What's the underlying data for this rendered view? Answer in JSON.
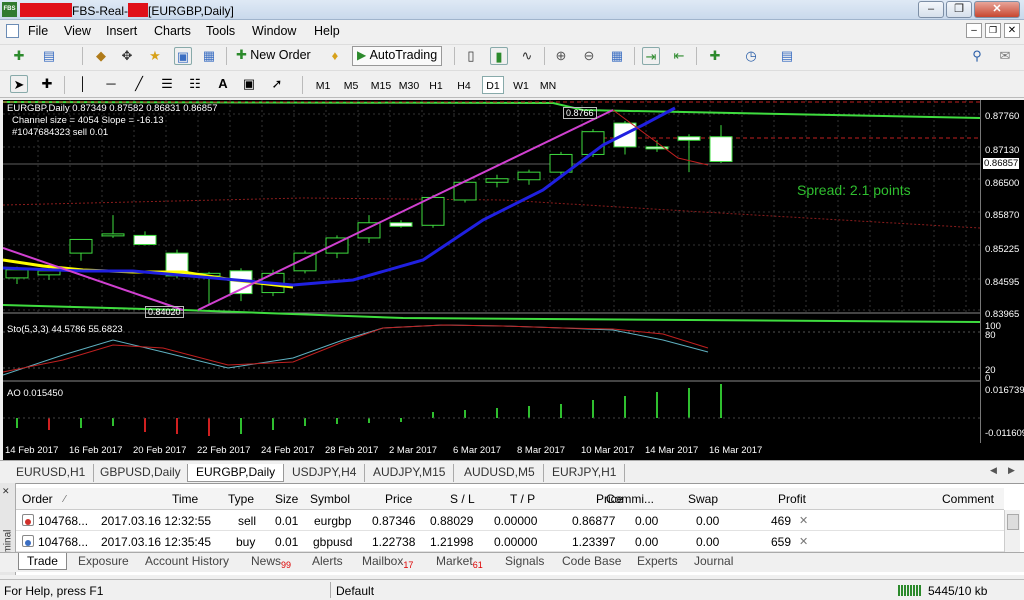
{
  "window": {
    "title": "FBS-Real-[EURGBP,Daily]",
    "app_icon_text": "FBS",
    "title_part1": "FBS-Real-",
    "title_part2": "[EURGBP,Daily]"
  },
  "menu": [
    "File",
    "View",
    "Insert",
    "Charts",
    "Tools",
    "Window",
    "Help"
  ],
  "toolbar": {
    "new_order": "New Order",
    "autotrading": "AutoTrading"
  },
  "timeframes": [
    "M1",
    "M5",
    "M15",
    "M30",
    "H1",
    "H4",
    "D1",
    "W1",
    "MN"
  ],
  "active_timeframe": "D1",
  "chart": {
    "header": "EURGBP,Daily  0.87349 0.87582 0.86831 0.86857",
    "channel_info": "Channel size = 4054 Slope = -16.13",
    "order_info": "#1047684323 sell 0.01",
    "spread": "Spread: 2.1 points",
    "high_label": "0.8766",
    "low_label": "0.84020",
    "price_labels": [
      "0.87760",
      "0.87130",
      "0.86857",
      "0.86500",
      "0.85870",
      "0.85225",
      "0.84595",
      "0.83965"
    ],
    "stoch_label": "Sto(5,3,3) 44.5786 55.6823",
    "stoch_levels": [
      "100",
      "80",
      "20",
      "0"
    ],
    "ao_label": "AO 0.015450",
    "ao_levels": [
      "0.016739",
      "-0.011609"
    ],
    "dates": [
      "14 Feb 2017",
      "16 Feb 2017",
      "20 Feb 2017",
      "22 Feb 2017",
      "24 Feb 2017",
      "28 Feb 2017",
      "2 Mar 2017",
      "6 Mar 2017",
      "8 Mar 2017",
      "10 Mar 2017",
      "14 Mar 2017",
      "16 Mar 2017"
    ]
  },
  "chart_data": {
    "type": "candlestick",
    "symbol": "EURGBP",
    "timeframe": "Daily",
    "ylim": [
      0.83965,
      0.8776
    ],
    "candles": [
      {
        "o": 0.8456,
        "h": 0.8478,
        "l": 0.8444,
        "c": 0.8472
      },
      {
        "o": 0.8462,
        "h": 0.8478,
        "l": 0.8452,
        "c": 0.847
      },
      {
        "o": 0.8505,
        "h": 0.8528,
        "l": 0.849,
        "c": 0.8532
      },
      {
        "o": 0.854,
        "h": 0.858,
        "l": 0.8535,
        "c": 0.8543
      },
      {
        "o": 0.854,
        "h": 0.8548,
        "l": 0.852,
        "c": 0.8522
      },
      {
        "o": 0.8505,
        "h": 0.8512,
        "l": 0.8455,
        "c": 0.846
      },
      {
        "o": 0.846,
        "h": 0.8468,
        "l": 0.8402,
        "c": 0.8465
      },
      {
        "o": 0.847,
        "h": 0.8475,
        "l": 0.841,
        "c": 0.8425
      },
      {
        "o": 0.8427,
        "h": 0.8472,
        "l": 0.842,
        "c": 0.8465
      },
      {
        "o": 0.847,
        "h": 0.851,
        "l": 0.8465,
        "c": 0.8505
      },
      {
        "o": 0.8505,
        "h": 0.854,
        "l": 0.8495,
        "c": 0.8535
      },
      {
        "o": 0.8535,
        "h": 0.858,
        "l": 0.8525,
        "c": 0.8565
      },
      {
        "o": 0.8565,
        "h": 0.857,
        "l": 0.8555,
        "c": 0.8558
      },
      {
        "o": 0.856,
        "h": 0.862,
        "l": 0.8555,
        "c": 0.8615
      },
      {
        "o": 0.861,
        "h": 0.865,
        "l": 0.8605,
        "c": 0.8645
      },
      {
        "o": 0.8645,
        "h": 0.866,
        "l": 0.8635,
        "c": 0.8652
      },
      {
        "o": 0.865,
        "h": 0.867,
        "l": 0.864,
        "c": 0.8665
      },
      {
        "o": 0.8665,
        "h": 0.8705,
        "l": 0.866,
        "c": 0.87
      },
      {
        "o": 0.87,
        "h": 0.875,
        "l": 0.8695,
        "c": 0.8745
      },
      {
        "o": 0.8762,
        "h": 0.8766,
        "l": 0.87,
        "c": 0.8715
      },
      {
        "o": 0.8715,
        "h": 0.8728,
        "l": 0.8705,
        "c": 0.8712
      },
      {
        "o": 0.8735,
        "h": 0.874,
        "l": 0.8665,
        "c": 0.8728
      },
      {
        "o": 0.8735,
        "h": 0.8758,
        "l": 0.8683,
        "c": 0.8686
      }
    ],
    "stochastic": {
      "main": 44.5786,
      "signal": 55.6823
    },
    "ao": {
      "last": 0.01545
    }
  },
  "chart_tabs": [
    "EURUSD,H1",
    "GBPUSD,Daily",
    "EURGBP,Daily",
    "USDJPY,H4",
    "AUDJPY,M15",
    "AUDUSD,M5",
    "EURJPY,H1"
  ],
  "active_chart_tab": "EURGBP,Daily",
  "terminal": {
    "side_label": "Terminal",
    "columns": [
      "Order",
      "Time",
      "Type",
      "Size",
      "Symbol",
      "Price",
      "S / L",
      "T / P",
      "Price",
      "Commi...",
      "Swap",
      "Profit",
      "Comment"
    ],
    "rows": [
      {
        "order": "104768...",
        "time": "2017.03.16 12:32:55",
        "type": "sell",
        "size": "0.01",
        "symbol": "eurgbp",
        "price": "0.87346",
        "sl": "0.88029",
        "tp": "0.00000",
        "cur_price": "0.86877",
        "commission": "0.00",
        "swap": "0.00",
        "profit": "469"
      },
      {
        "order": "104768...",
        "time": "2017.03.16 12:35:45",
        "type": "buy",
        "size": "0.01",
        "symbol": "gbpusd",
        "price": "1.22738",
        "sl": "1.21998",
        "tp": "0.00000",
        "cur_price": "1.23397",
        "commission": "0.00",
        "swap": "0.00",
        "profit": "659"
      }
    ],
    "tabs": [
      {
        "label": "Trade",
        "badge": ""
      },
      {
        "label": "Exposure",
        "badge": ""
      },
      {
        "label": "Account History",
        "badge": ""
      },
      {
        "label": "News",
        "badge": "99"
      },
      {
        "label": "Alerts",
        "badge": ""
      },
      {
        "label": "Mailbox",
        "badge": "17"
      },
      {
        "label": "Market",
        "badge": "61"
      },
      {
        "label": "Signals",
        "badge": ""
      },
      {
        "label": "Code Base",
        "badge": ""
      },
      {
        "label": "Experts",
        "badge": ""
      },
      {
        "label": "Journal",
        "badge": ""
      }
    ]
  },
  "status": {
    "help": "For Help, press F1",
    "profile": "Default",
    "traffic": "5445/10 kb"
  }
}
